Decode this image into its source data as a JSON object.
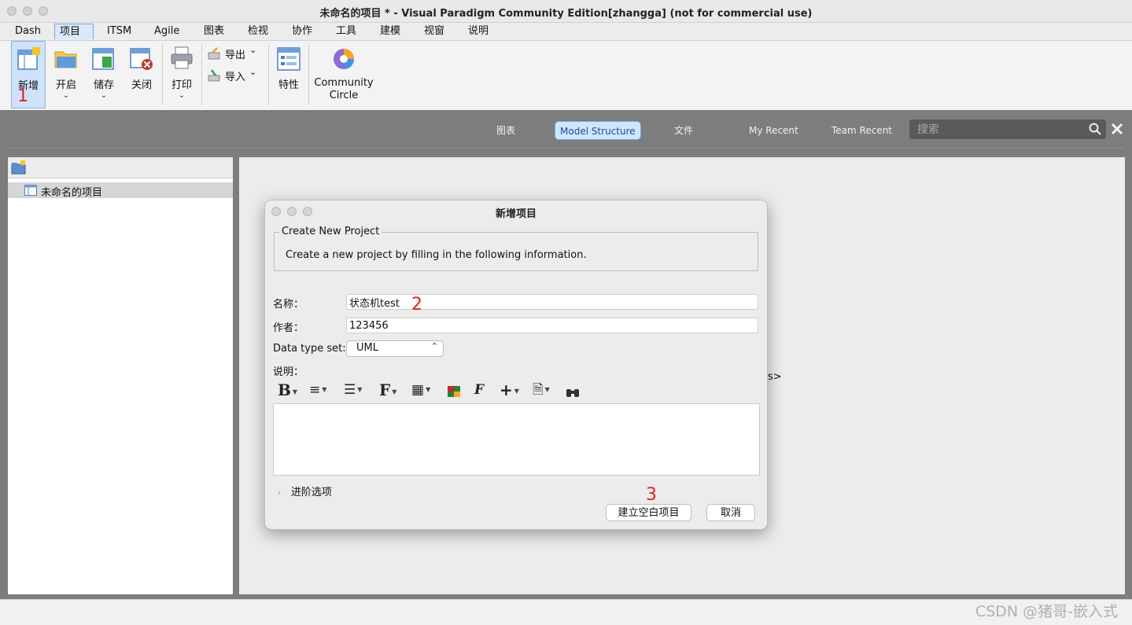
{
  "window": {
    "title": "未命名的项目 * - Visual Paradigm Community Edition[zhangga] (not for commercial use)"
  },
  "menu": {
    "tabs": [
      "Dash",
      "项目",
      "ITSM",
      "Agile",
      "图表",
      "检视",
      "协作",
      "工具",
      "建模",
      "视窗",
      "说明"
    ],
    "active_index": 1
  },
  "ribbon": {
    "new": "新增",
    "open": "开启",
    "save": "储存",
    "close": "关闭",
    "print": "打印",
    "export": "导出",
    "import": "导入",
    "properties": "特性",
    "community_line1": "Community",
    "community_line2": "Circle"
  },
  "annotations": {
    "step1": "1",
    "step2": "2",
    "step3": "3"
  },
  "nav": {
    "tabs": [
      "图表",
      "Model Structure",
      "文件",
      "My Recent",
      "Team Recent"
    ],
    "active_index": 1,
    "search_placeholder": "搜索"
  },
  "tree": {
    "root_item": "未命名的项目"
  },
  "dialog": {
    "title": "新增项目",
    "group_title": "Create New Project",
    "group_desc": "Create a new project by filling in the following information.",
    "name_label": "名称：",
    "name_value": "状态机test",
    "author_label": "作者：",
    "author_value": "123456",
    "datatype_label": "Data type set:",
    "datatype_value": "UML",
    "desc_label": "说明：",
    "advanced_label": "进阶选项",
    "create_button": "建立空白项目",
    "cancel_button": "取消"
  },
  "canvas": {
    "stray_text": "s>"
  },
  "watermark": "CSDN @猪哥-嵌入式",
  "colors": {
    "accent": "#7aa6dc",
    "annotation_red": "#e02020",
    "workspace_gray": "#7d7d7d"
  }
}
